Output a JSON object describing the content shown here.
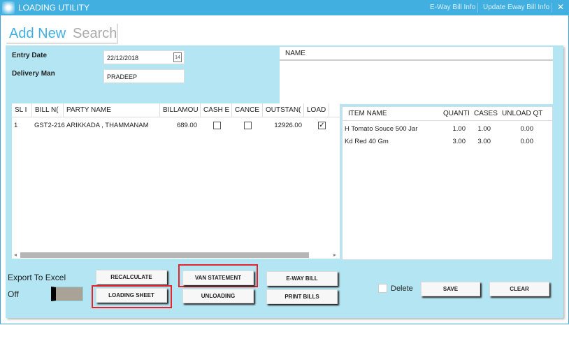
{
  "window": {
    "title": "LOADING UTILITY",
    "links": [
      "E-Way Bill Info",
      "Update Eway Bill Info"
    ],
    "close": "✕"
  },
  "tabs": {
    "add_new": "Add New",
    "search": "Search"
  },
  "form": {
    "entry_date_label": "Entry Date",
    "entry_date": "22/12/2018",
    "calendar_day": "14",
    "delivery_man_label": "Delivery Man",
    "delivery_man": "PRADEEP"
  },
  "name_list": {
    "header": "NAME"
  },
  "bills": {
    "columns": [
      "SL I",
      "BILL N(",
      "PARTY NAME",
      "BILLAMOU",
      "CASH E",
      "CANCE",
      "OUTSTAN(",
      "LOAD"
    ],
    "rows": [
      {
        "sl": "1",
        "bill_no": "GST2-216",
        "party": "ARIKKADA , THAMMANAM",
        "amount": "689.00",
        "cash": false,
        "cancel": false,
        "outstanding": "12926.00",
        "load": true
      }
    ]
  },
  "items": {
    "columns": [
      "ITEM NAME",
      "QUANTI",
      "CASES",
      "UNLOAD QT"
    ],
    "rows": [
      {
        "name": "H Tomato Souce 500 Jar",
        "qty": "1.00",
        "cases": "1.00",
        "unload": "0.00"
      },
      {
        "name": "Kd Red 40 Gm",
        "qty": "3.00",
        "cases": "3.00",
        "unload": "0.00"
      }
    ]
  },
  "export": {
    "label": "Export To Excel",
    "state": "Off"
  },
  "buttons": {
    "recalculate": "RECALCULATE",
    "loading_sheet": "LOADING SHEET",
    "van_statement": "VAN STATEMENT",
    "unloading": "UNLOADING",
    "eway_bill": "E-WAY BILL",
    "print_bills": "PRINT BILLS",
    "delete": "Delete",
    "save": "SAVE",
    "clear": "CLEAR"
  },
  "colors": {
    "titlebar": "#41afe0",
    "panel": "#b3e5f3",
    "highlight": "#e8212a"
  }
}
